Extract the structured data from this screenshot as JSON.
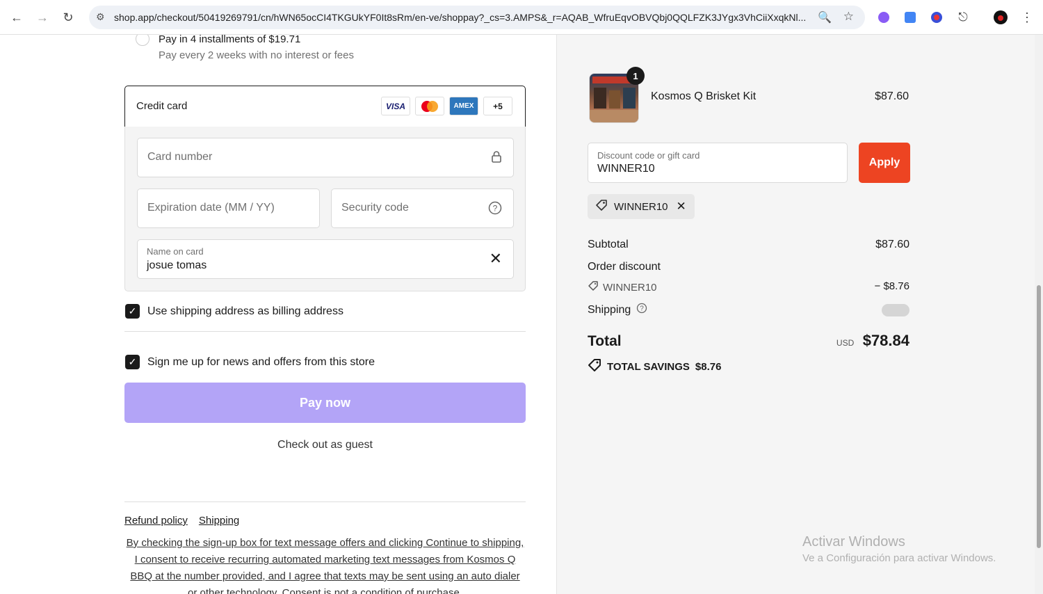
{
  "browser": {
    "url": "shop.app/checkout/50419269791/cn/hWN65ocCI4TKGUkYF0It8sRm/en-ve/shoppay?_cs=3.AMPS&_r=AQAB_WfruEqvOBVQbj0QQLFZK3JYgx3VhCiiXxqkNl..."
  },
  "installments": {
    "title": "Pay in 4 installments of $19.71",
    "subtitle": "Pay every 2 weeks with no interest or fees"
  },
  "credit_card": {
    "label": "Credit card",
    "logos": [
      "VISA",
      "",
      "AMEX",
      "+5"
    ],
    "card_number_placeholder": "Card number",
    "expiration_placeholder": "Expiration date (MM / YY)",
    "security_placeholder": "Security code",
    "name_label": "Name on card",
    "name_value": "josue tomas"
  },
  "billing": {
    "use_shipping_label": "Use shipping address as billing address",
    "use_shipping_checked": true
  },
  "newsletter": {
    "label": "Sign me up for news and offers from this store",
    "checked": true
  },
  "pay_button": "Pay now",
  "guest_link": "Check out as guest",
  "footer_links": [
    "Refund policy",
    "Shipping"
  ],
  "legal_text": "By checking the sign-up box for text message offers and clicking Continue to shipping, I consent to receive recurring automated marketing text messages from Kosmos Q BBQ at the number provided, and I agree that texts may be sent using an auto dialer or other technology. Consent is not a condition of purchase.",
  "order": {
    "quantity": "1",
    "product_name": "Kosmos Q Brisket Kit",
    "product_price": "$87.60",
    "discount_label": "Discount code or gift card",
    "discount_value": "WINNER10",
    "apply_label": "Apply",
    "applied_code": "WINNER10",
    "subtotal_label": "Subtotal",
    "subtotal_value": "$87.60",
    "order_discount_label": "Order discount",
    "discount_code": "WINNER10",
    "discount_amount": "− $8.76",
    "shipping_label": "Shipping",
    "total_label": "Total",
    "currency": "USD",
    "total_value": "$78.84",
    "savings_label": "TOTAL SAVINGS",
    "savings_value": "$8.76"
  },
  "windows_watermark": {
    "title": "Activar Windows",
    "subtitle": "Ve a Configuración para activar Windows."
  },
  "colors": {
    "pay_button": "#b3a4f7",
    "apply_button": "#ed4422",
    "amex": "#2e77bc"
  }
}
